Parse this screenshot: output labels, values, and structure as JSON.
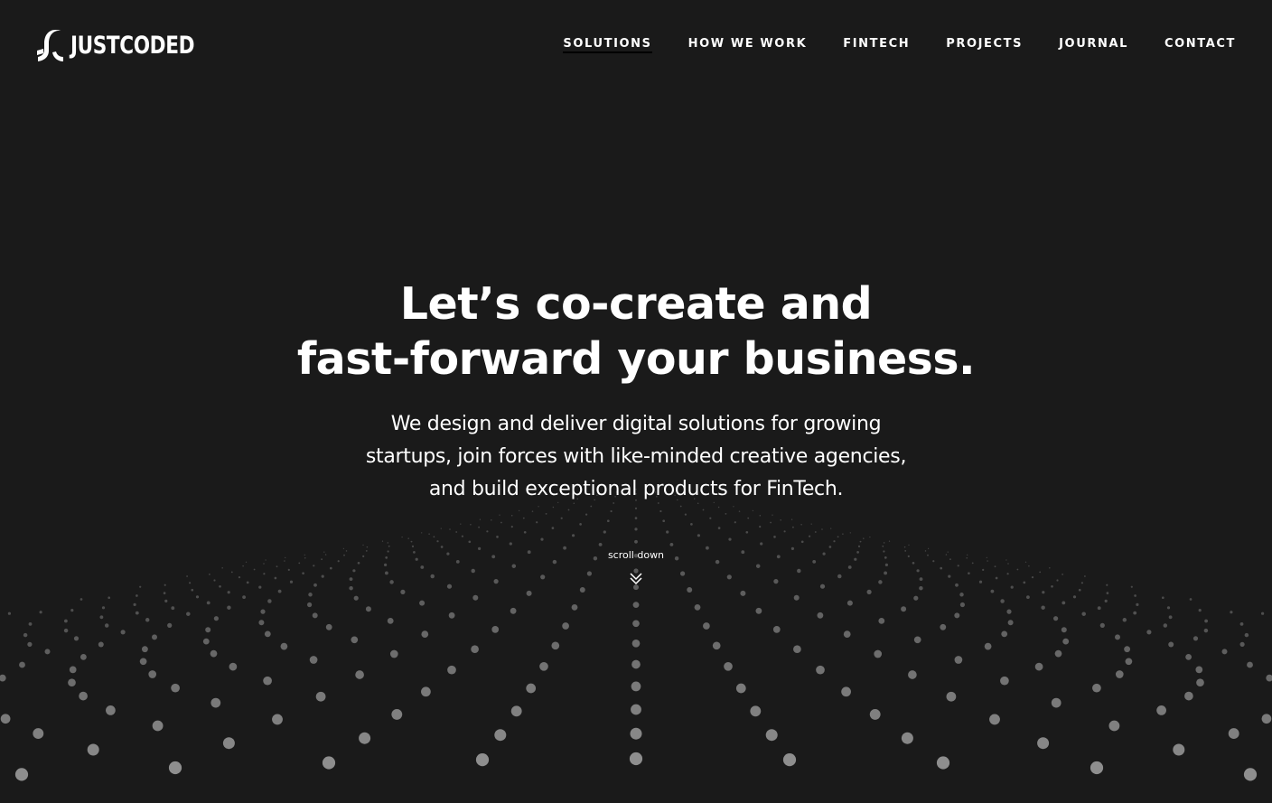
{
  "brand": {
    "name": "JUSTCODED",
    "logo_icon": "justcoded-logo-mark"
  },
  "nav": {
    "items": [
      {
        "label": "SOLUTIONS",
        "active": true
      },
      {
        "label": "HOW WE WORK",
        "active": false
      },
      {
        "label": "FINTECH",
        "active": false
      },
      {
        "label": "PROJECTS",
        "active": false
      },
      {
        "label": "JOURNAL",
        "active": false
      },
      {
        "label": "CONTACT",
        "active": false
      }
    ]
  },
  "hero": {
    "headline_line1": "Let’s co-create and",
    "headline_line2": "fast-forward your business.",
    "sub_line1": "We design and deliver digital solutions for growing",
    "sub_line2": "startups, join forces with like-minded creative agencies,",
    "sub_line3": "and build exceptional products for FinTech."
  },
  "scroll": {
    "label": "scroll down",
    "icon": "double-chevron-down-icon"
  },
  "colors": {
    "background": "#1a1a1a",
    "text": "#ffffff",
    "dots": "#8e8e8e"
  }
}
